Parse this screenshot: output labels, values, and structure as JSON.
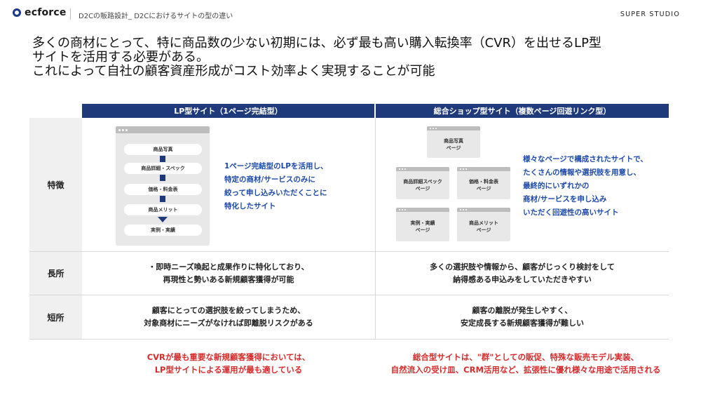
{
  "header": {
    "logo_text": "ecforce",
    "breadcrumb": "D2Cの販路設計_ D2Cにおけるサイトの型の違い",
    "brand": "SUPER STUDIO"
  },
  "headline": {
    "lines": [
      "多くの商材にとって、特に商品数の少ない初期には、必ず最も高い購入転換率（CVR）を出せるLP型",
      "サイトを活用する必要がある。",
      "これによって自社の顧客資産形成がコスト効率よく実現することが可能"
    ]
  },
  "table": {
    "columns": [
      "LP型サイト（1ページ完結型）",
      "総合ショップ型サイト（複数ページ回遊リンク型）"
    ],
    "rows": {
      "features": {
        "label": "特徴",
        "lp_steps": [
          "商品写真",
          "商品詳細・スペック",
          "価格・料金表",
          "商品メリット",
          "実例・実績"
        ],
        "lp_description": [
          "1ページ完結型のLPを活用し、",
          "特定の商材/サービスのみに",
          "絞って申し込みいただくことに",
          "特化したサイト"
        ],
        "shop_pages": [
          [
            "商品写真",
            "ページ"
          ],
          [
            "商品詳細スペック",
            "ページ"
          ],
          [
            "価格・料金表",
            "ページ"
          ],
          [
            "実例・実績",
            "ページ"
          ],
          [
            "商品メリット",
            "ページ"
          ]
        ],
        "shop_description": [
          "様々なページで構成されたサイトで、",
          "たくさんの情報や選択肢を用意し、",
          "最終的にいずれかの",
          "商材/サービスを申し込み",
          "いただく回遊性の高いサイト"
        ]
      },
      "pros": {
        "label": "長所",
        "lp": [
          "・即時ニーズ喚起と成果作りに特化しており、",
          "再現性と勢いある新規顧客獲得が可能"
        ],
        "shop": [
          "多くの選択肢や情報から、顧客がじっくり検討をして",
          "納得感ある申込みをしていただきやすい"
        ]
      },
      "cons": {
        "label": "短所",
        "lp": [
          "顧客にとっての選択肢を絞ってしまうため、",
          "対象商材にニーズがなければ即離脱リスクがある"
        ],
        "shop": [
          "顧客の離脱が発生しやすく、",
          "安定成長する新規顧客獲得が難しい"
        ]
      }
    }
  },
  "conclusions": {
    "lp": [
      "CVRが最も重要な新規顧客獲得においては、",
      "LP型サイトによる運用が最も適している"
    ],
    "shop": [
      "総合型サイトは、\"群\"としての販促、特殊な販売モデル実装、",
      "自然流入の受け皿、CRM活用など、拡張性に優れ様々な用途で活用される"
    ]
  },
  "colors": {
    "header_navy": "#1f3a7a",
    "description_blue": "#1d4aa8",
    "conclusion_red": "#d62b2b"
  }
}
